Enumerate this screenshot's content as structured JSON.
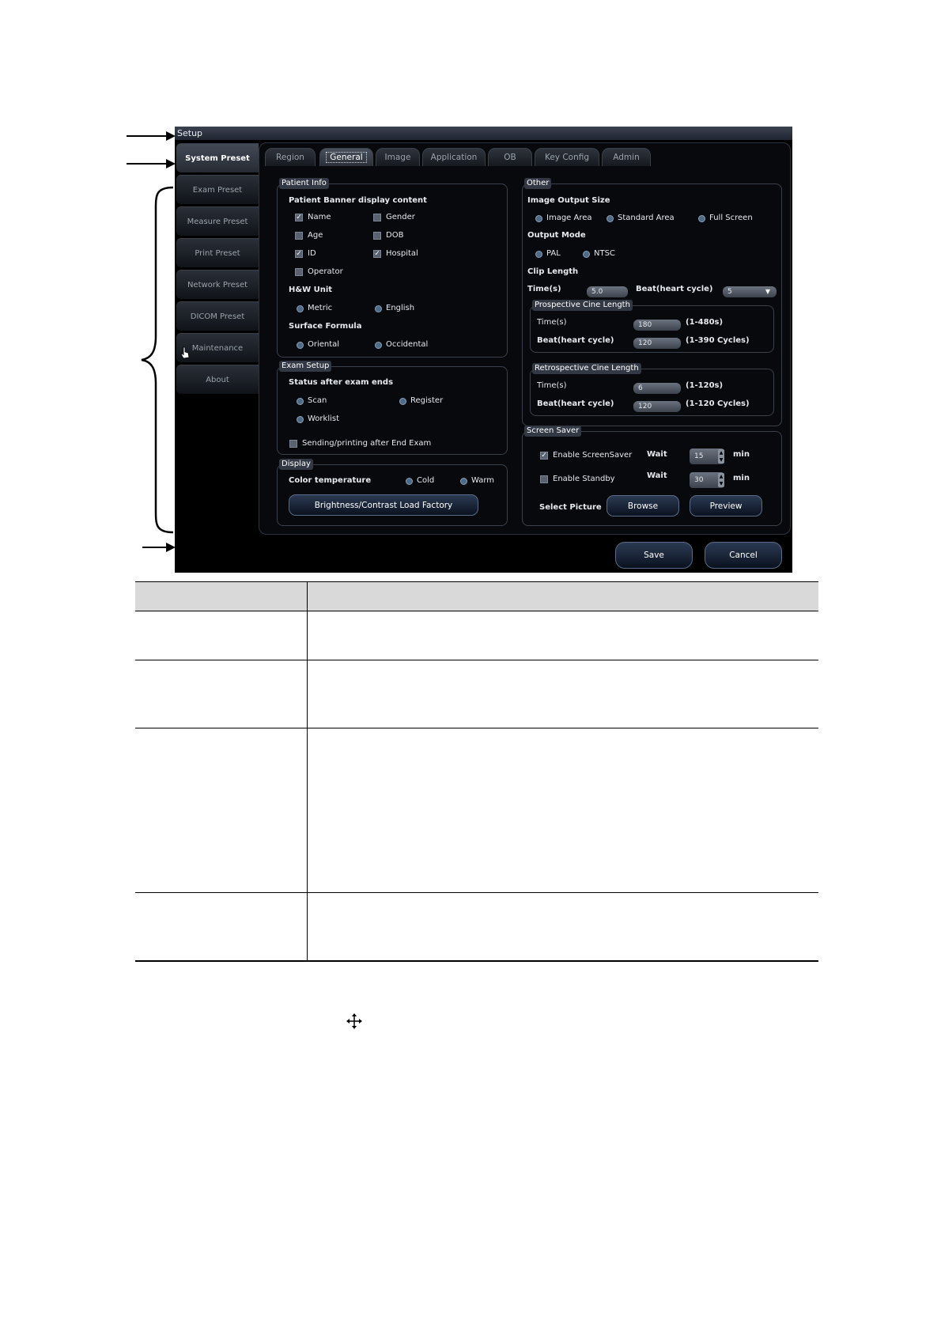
{
  "window": {
    "title": "Setup"
  },
  "sidebar": {
    "items": [
      {
        "label": "System Preset"
      },
      {
        "label": "Exam Preset"
      },
      {
        "label": "Measure Preset"
      },
      {
        "label": "Print Preset"
      },
      {
        "label": "Network Preset"
      },
      {
        "label": "DICOM Preset"
      },
      {
        "label": "Maintenance"
      },
      {
        "label": "About"
      }
    ]
  },
  "tabs": [
    {
      "label": "Region"
    },
    {
      "label": "General"
    },
    {
      "label": "Image"
    },
    {
      "label": "Application"
    },
    {
      "label": "OB"
    },
    {
      "label": "Key Config"
    },
    {
      "label": "Admin"
    }
  ],
  "patient_info": {
    "title": "Patient Info",
    "banner_label": "Patient Banner display content",
    "name": "Name",
    "gender": "Gender",
    "age": "Age",
    "dob": "DOB",
    "id": "ID",
    "hospital": "Hospital",
    "operator": "Operator",
    "hw_unit": "H&W Unit",
    "metric": "Metric",
    "english": "English",
    "surface_formula": "Surface Formula",
    "oriental": "Oriental",
    "occidental": "Occidental"
  },
  "exam_setup": {
    "title": "Exam Setup",
    "status_label": "Status after exam ends",
    "scan": "Scan",
    "register": "Register",
    "worklist": "Worklist",
    "sending": "Sending/printing after End Exam"
  },
  "display": {
    "title": "Display",
    "color_temp": "Color temperature",
    "cold": "Cold",
    "warm": "Warm",
    "brightness_button": "Brightness/Contrast Load Factory"
  },
  "other": {
    "title": "Other",
    "output_size": "Image Output Size",
    "image_area": "Image Area",
    "standard_area": "Standard Area",
    "full_screen": "Full Screen",
    "output_mode": "Output Mode",
    "pal": "PAL",
    "ntsc": "NTSC",
    "clip_length": "Clip Length",
    "time_label": "Time(s)",
    "time_value": "5.0",
    "beat_label": "Beat(heart cycle)",
    "beat_value": "5",
    "prospective": {
      "title": "Prospective Cine Length",
      "time_label": "Time(s)",
      "time_value": "180",
      "time_range": "(1-480s)",
      "beat_label": "Beat(heart cycle)",
      "beat_value": "120",
      "beat_range": "(1-390 Cycles)"
    },
    "retrospective": {
      "title": "Retrospective Cine Length",
      "time_label": "Time(s)",
      "time_value": "6",
      "time_range": "(1-120s)",
      "beat_label": "Beat(heart cycle)",
      "beat_value": "120",
      "beat_range": "(1-120 Cycles)"
    }
  },
  "screen_saver": {
    "title": "Screen Saver",
    "enable_saver": "Enable ScreenSaver",
    "wait1": "Wait",
    "wait1_value": "15",
    "min1": "min",
    "enable_standby": "Enable Standby",
    "wait2": "Wait",
    "wait2_value": "30",
    "min2": "min",
    "select_picture": "Select Picture",
    "browse": "Browse",
    "preview": "Preview"
  },
  "footer": {
    "save": "Save",
    "cancel": "Cancel"
  },
  "icons": {
    "cursor": "hand-pointer-icon",
    "move": "move-arrows-icon"
  }
}
